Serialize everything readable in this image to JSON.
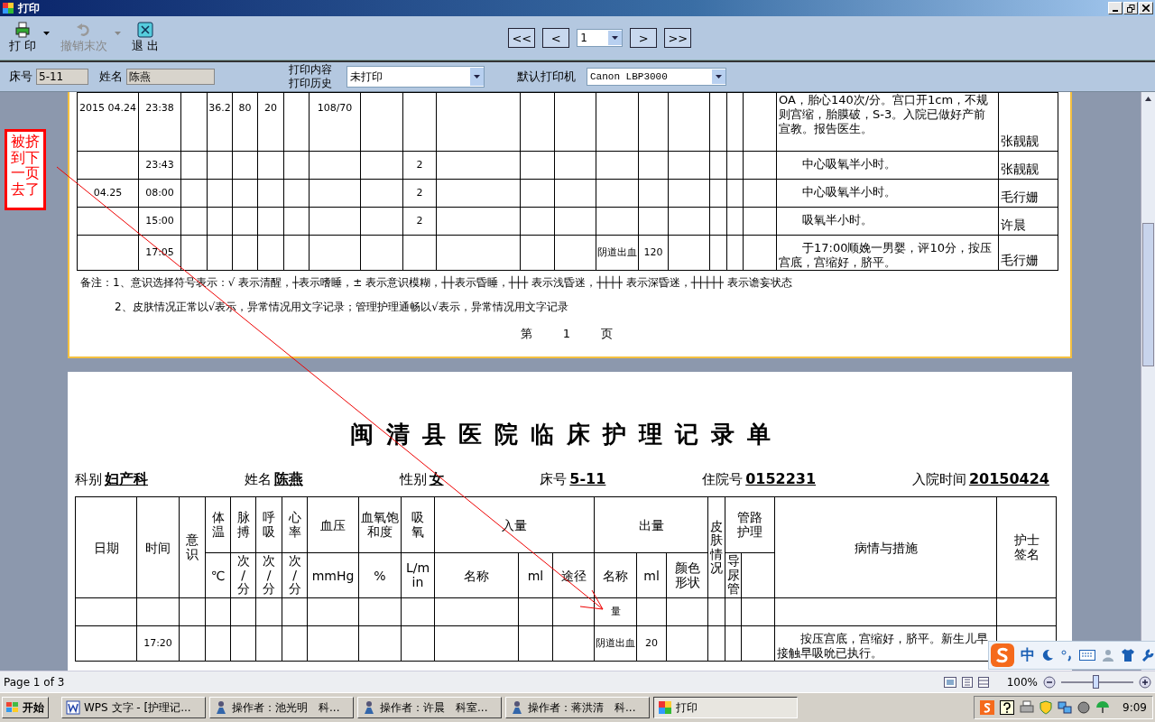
{
  "window": {
    "title": "打印"
  },
  "toolbar": {
    "buttons": [
      {
        "kind": "print",
        "label": "打 印",
        "disabled": false,
        "dropdown": true
      },
      {
        "kind": "undo",
        "label": "撤销末次",
        "disabled": true,
        "dropdown": true
      },
      {
        "kind": "exit",
        "label": "退 出",
        "disabled": false,
        "dropdown": false
      }
    ],
    "pager": {
      "first": "<<",
      "prev": "<",
      "page": "1",
      "next": ">",
      "last": ">>"
    }
  },
  "info": {
    "bed_label": "床号",
    "bed_value": "5-11",
    "name_label": "姓名",
    "name_value": "陈燕",
    "content_label": "打印内容",
    "history_label": "打印历史",
    "content_select": "未打印",
    "printer_label": "默认打印机",
    "printer_select": "Canon LBP3000"
  },
  "page1": {
    "rows": [
      {
        "date": "2015 04.24",
        "time": "23:38",
        "temp": "36.2",
        "pulse": "80",
        "resp": "20",
        "bp": "108/70",
        "notes": "OA，胎心140次/分。宫口开1cm，不规则宫缩，胎膜破，S-3。入院已做好产前宣教。报告医生。",
        "nurse": "张靓靓"
      },
      {
        "time": "23:43",
        "oxygen": "2",
        "notes": "中心吸氧半小时。",
        "nurse": "张靓靓"
      },
      {
        "date": "04.25",
        "time": "08:00",
        "oxygen": "2",
        "notes": "中心吸氧半小时。",
        "nurse": "毛行姗"
      },
      {
        "time": "15:00",
        "oxygen": "2",
        "notes": "吸氧半小时。",
        "nurse": "许晨"
      },
      {
        "time": "17:05",
        "out_name": "阴道出血",
        "out_ml": "120",
        "notes": "于17:00顺娩一男婴，评10分，按压宫底，宫缩好，脐平。",
        "nurse": "毛行姗"
      }
    ],
    "remarks": [
      "备注：1、意识选择符号表示：√ 表示清醒，┼表示嗜睡，± 表示意识模糊，┼┼表示昏睡，┼┼┼ 表示浅昏迷，┼┼┼┼ 表示深昏迷，┼┼┼┼┼ 表示谵妄状态",
      "2、皮肤情况正常以√表示，异常情况用文字记录；管理护理通畅以√表示，异常情况用文字记录"
    ],
    "page_number": "第 1 页"
  },
  "page2": {
    "title": "闽清县医院临床护理记录单",
    "fields": [
      {
        "label": "科别",
        "value": "妇产科"
      },
      {
        "label": "姓名",
        "value": "陈燕"
      },
      {
        "label": "性别",
        "value": "女"
      },
      {
        "label": "床号",
        "value": "5-11"
      },
      {
        "label": "住院号",
        "value": "0152231"
      },
      {
        "label": "入院时间",
        "value": "20150424"
      }
    ],
    "header_rows": [
      [
        {
          "text": "日期"
        },
        {
          "text": "时间"
        },
        {
          "text": "意识"
        },
        {
          "text": "体温"
        },
        {
          "text": "脉搏"
        },
        {
          "text": "呼吸"
        },
        {
          "text": "心率"
        },
        {
          "text": "血压"
        },
        {
          "text": "血氧饱和度"
        },
        {
          "text": "吸氧"
        },
        {
          "text": "入量"
        },
        {
          "text": "出量"
        },
        {
          "text": "皮肤情况"
        },
        {
          "text": "管路护理"
        },
        {
          "text": "病情与措施"
        },
        {
          "text": "护士签名"
        }
      ],
      [
        {
          "text": "℃"
        },
        {
          "text": "次/分"
        },
        {
          "text": "次/分"
        },
        {
          "text": "次/分"
        },
        {
          "text": "mmHg"
        },
        {
          "text": "%"
        },
        {
          "text": "L/min"
        },
        {
          "text": "名称"
        },
        {
          "text": "ml"
        },
        {
          "text": "途径"
        },
        {
          "text": "名称"
        },
        {
          "text": "ml"
        },
        {
          "text": "颜色形状"
        },
        {
          "text": "导尿管"
        },
        {}
      ]
    ],
    "rows": [
      {
        "out_name": "量"
      },
      {
        "time": "17:20",
        "out_name": "阴道出血",
        "out_ml": "20",
        "notes": "按压宫底，宫缩好，脐平。新生儿早接触早吸吮已执行。"
      }
    ]
  },
  "annotation": "被挤到下一页去了",
  "status_bar": {
    "page": "Page 1 of 3",
    "zoom": "100%",
    "zoom_level": {
      "level": 0.47
    }
  },
  "ime": {
    "mode": "中"
  },
  "taskbar": {
    "start": "开始",
    "tasks": [
      {
        "label": "WPS 文字 - [护理记...",
        "kind": "doc",
        "selected": false
      },
      {
        "label": "操作者：池光明　科...",
        "kind": "app",
        "selected": false
      },
      {
        "label": "操作者：许晨　科室...",
        "kind": "app",
        "selected": false
      },
      {
        "label": "操作者：蒋洪清　科...",
        "kind": "app",
        "selected": false
      },
      {
        "label": "打印",
        "kind": "window",
        "selected": true
      }
    ],
    "clock": "9:09"
  }
}
